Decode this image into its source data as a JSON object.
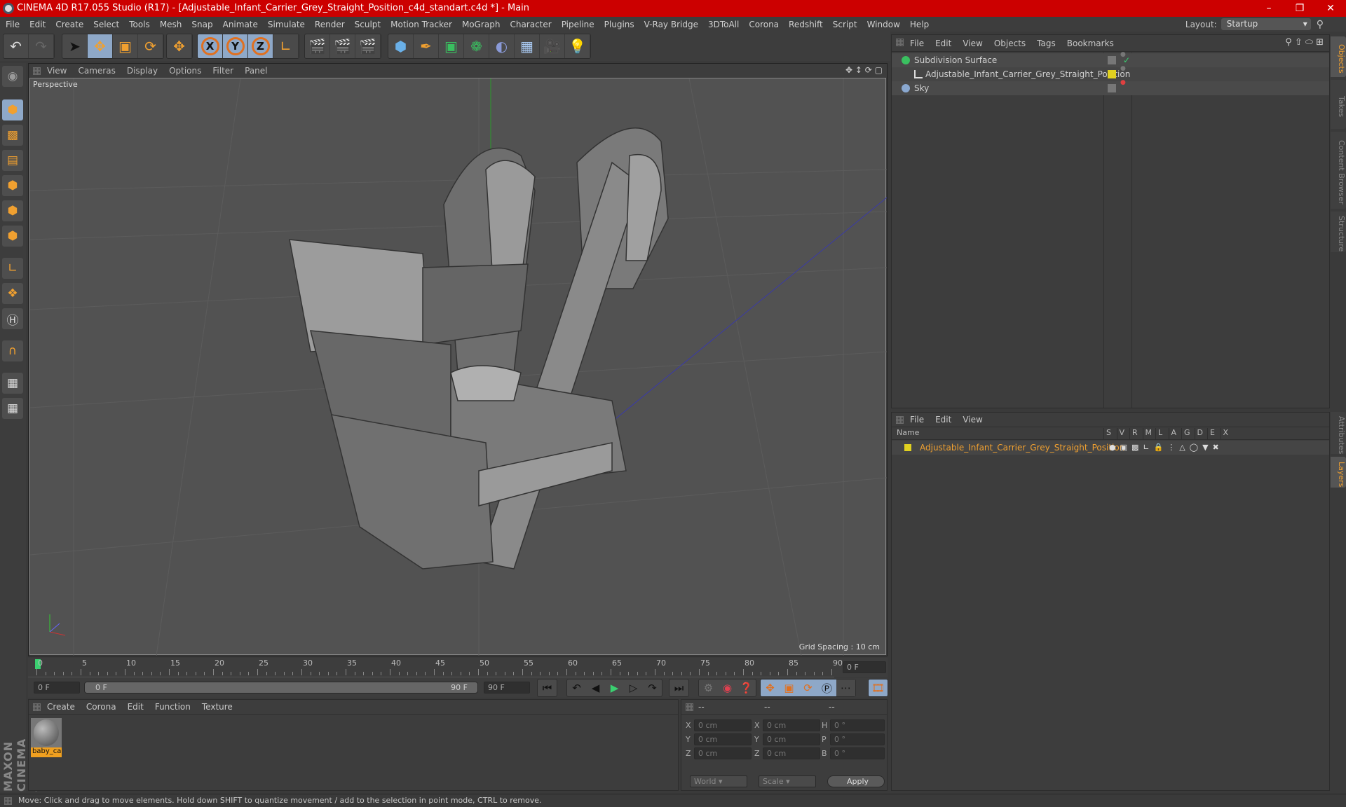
{
  "app": {
    "title": "CINEMA 4D R17.055 Studio (R17) - [Adjustable_Infant_Carrier_Grey_Straight_Position_c4d_standart.c4d *] - Main",
    "window_controls": [
      "minimize-icon",
      "restore-icon",
      "close-icon"
    ]
  },
  "menu": [
    "File",
    "Edit",
    "Create",
    "Select",
    "Tools",
    "Mesh",
    "Snap",
    "Animate",
    "Simulate",
    "Render",
    "Sculpt",
    "Motion Tracker",
    "MoGraph",
    "Character",
    "Pipeline",
    "Plugins",
    "V-Ray Bridge",
    "3DToAll",
    "Corona",
    "Redshift",
    "Script",
    "Window",
    "Help"
  ],
  "layout": {
    "label": "Layout:",
    "value": "Startup"
  },
  "toolbar": {
    "axes": [
      "X",
      "Y",
      "Z"
    ]
  },
  "viewport": {
    "menu": [
      "View",
      "Cameras",
      "Display",
      "Options",
      "Filter",
      "Panel"
    ],
    "camera": "Perspective",
    "grid_spacing": "Grid Spacing : 10 cm"
  },
  "timeline": {
    "ticks": [
      "0",
      "5",
      "10",
      "15",
      "20",
      "25",
      "30",
      "35",
      "40",
      "45",
      "50",
      "55",
      "60",
      "65",
      "70",
      "75",
      "80",
      "85",
      "90"
    ],
    "current_frame": "0 F",
    "start": "0 F",
    "range_start": "0 F",
    "range_end": "90 F",
    "end": "90 F"
  },
  "materials": {
    "menu": [
      "Create",
      "Corona",
      "Edit",
      "Function",
      "Texture"
    ],
    "items": [
      {
        "name": "baby_ca"
      }
    ]
  },
  "coords": {
    "headers": [
      "--",
      "--",
      "--"
    ],
    "rows": [
      {
        "l1": "X",
        "v1": "0 cm",
        "l2": "X",
        "v2": "0 cm",
        "l3": "H",
        "v3": "0 °"
      },
      {
        "l1": "Y",
        "v1": "0 cm",
        "l2": "Y",
        "v2": "0 cm",
        "l3": "P",
        "v3": "0 °"
      },
      {
        "l1": "Z",
        "v1": "0 cm",
        "l2": "Z",
        "v2": "0 cm",
        "l3": "B",
        "v3": "0 °"
      }
    ],
    "mode": "World",
    "type": "Scale",
    "apply": "Apply"
  },
  "objects": {
    "menu": [
      "File",
      "Edit",
      "View",
      "Objects",
      "Tags",
      "Bookmarks"
    ],
    "items": [
      {
        "name": "Subdivision Surface",
        "color": "#3ac060"
      },
      {
        "name": "Adjustable_Infant_Carrier_Grey_Straight_Position",
        "color": "#e0d020"
      },
      {
        "name": "Sky",
        "color": "#8aa8d0"
      }
    ]
  },
  "layers": {
    "menu": [
      "File",
      "Edit",
      "View"
    ],
    "columns": [
      "Name",
      "S",
      "V",
      "R",
      "M",
      "L",
      "A",
      "G",
      "D",
      "E",
      "X"
    ],
    "items": [
      {
        "name": "Adjustable_Infant_Carrier_Grey_Straight_Position",
        "color": "#e0d020"
      }
    ]
  },
  "right_tabs": [
    "Objects",
    "Takes",
    "Content Browser",
    "Structure",
    "Attributes",
    "Layers"
  ],
  "branding": "MAXON CINEMA 4D",
  "status": "Move: Click and drag to move elements. Hold down SHIFT to quantize movement / add to the selection in point mode, CTRL to remove.",
  "colors": {
    "titlebar": "#cc0000",
    "accent": "#f0a030",
    "selected_tool": "#8ea8c8"
  }
}
